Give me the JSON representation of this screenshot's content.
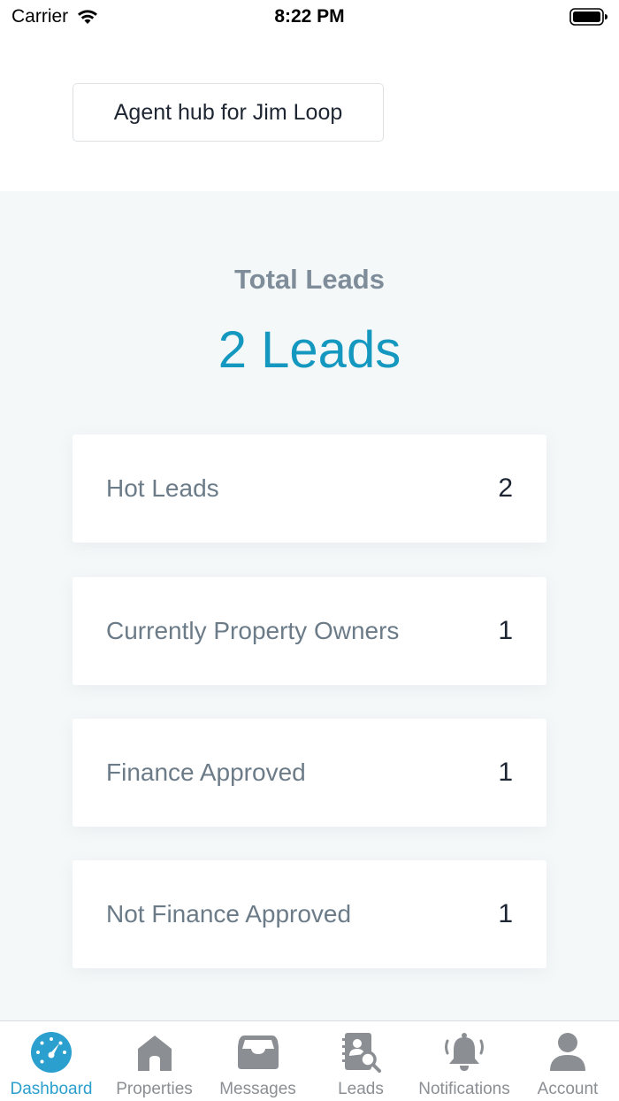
{
  "status_bar": {
    "carrier": "Carrier",
    "time": "8:22 PM"
  },
  "header": {
    "hub_title": "Agent hub for Jim Loop"
  },
  "summary": {
    "label": "Total Leads",
    "value": "2 Leads"
  },
  "stats": [
    {
      "label": "Hot Leads",
      "value": "2"
    },
    {
      "label": "Currently Property Owners",
      "value": "1"
    },
    {
      "label": "Finance Approved",
      "value": "1"
    },
    {
      "label": "Not Finance Approved",
      "value": "1"
    }
  ],
  "tabs": [
    {
      "label": "Dashboard",
      "icon": "dashboard-icon",
      "active": true
    },
    {
      "label": "Properties",
      "icon": "home-icon",
      "active": false
    },
    {
      "label": "Messages",
      "icon": "inbox-icon",
      "active": false
    },
    {
      "label": "Leads",
      "icon": "contact-book-search-icon",
      "active": false
    },
    {
      "label": "Notifications",
      "icon": "bell-icon",
      "active": false
    },
    {
      "label": "Account",
      "icon": "user-icon",
      "active": false
    }
  ],
  "colors": {
    "accent": "#2b9fcd",
    "total_value": "#1598bf",
    "inactive_tab": "#8b8f93",
    "background": "#f5f8f9"
  }
}
